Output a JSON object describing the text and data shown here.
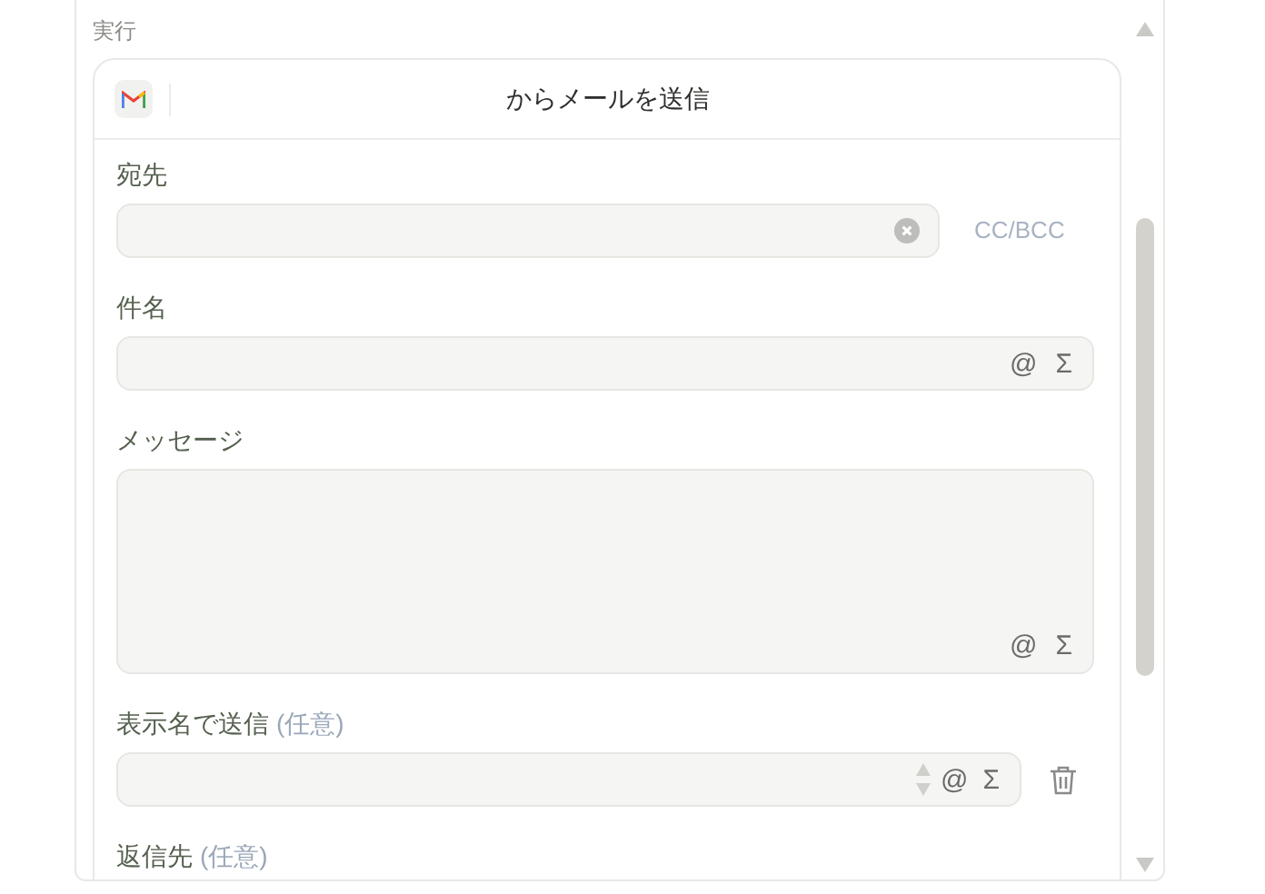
{
  "section_label": "実行",
  "card": {
    "title": "からメールを送信"
  },
  "fields": [
    {
      "kind": "recipient",
      "label": "宛先",
      "side_link": "CC/BCC"
    },
    {
      "kind": "text",
      "label": "件名",
      "insert_buttons": [
        "@",
        "Σ"
      ]
    },
    {
      "kind": "textarea",
      "label": "メッセージ",
      "insert_buttons": [
        "@",
        "Σ"
      ]
    },
    {
      "kind": "removable",
      "label": "表示名で送信",
      "optional_note": "(任意)",
      "insert_buttons": [
        "@",
        "Σ"
      ]
    },
    {
      "kind": "label_only",
      "label": "返信先",
      "optional_note": "(任意)"
    }
  ]
}
